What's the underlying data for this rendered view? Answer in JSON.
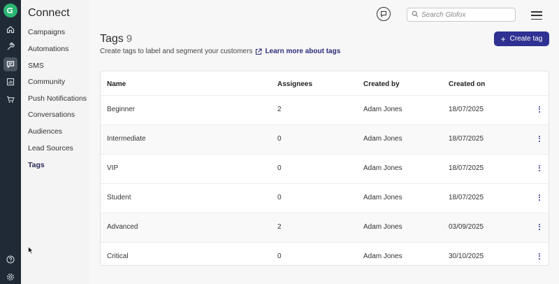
{
  "rail": {
    "icons": [
      "home-icon",
      "wrench-icon",
      "message-icon",
      "chart-icon",
      "cart-icon",
      "help-icon",
      "settings-icon"
    ]
  },
  "subnav": {
    "title": "Connect",
    "items": [
      {
        "label": "Campaigns"
      },
      {
        "label": "Automations"
      },
      {
        "label": "SMS"
      },
      {
        "label": "Community"
      },
      {
        "label": "Push Notifications"
      },
      {
        "label": "Conversations"
      },
      {
        "label": "Audiences"
      },
      {
        "label": "Lead Sources"
      },
      {
        "label": "Tags",
        "active": true
      }
    ]
  },
  "header": {
    "search_placeholder": "Search Glofox"
  },
  "page": {
    "title": "Tags",
    "count": "9",
    "subtitle": "Create tags to label and segment your customers",
    "learn_more": "Learn more about tags",
    "create_button": "Create tag"
  },
  "table": {
    "columns": [
      "Name",
      "Assignees",
      "Created by",
      "Created on"
    ],
    "rows": [
      {
        "name": "Beginner",
        "assignees": "2",
        "created_by": "Adam Jones",
        "created_on": "18/07/2025"
      },
      {
        "name": "Intermediate",
        "assignees": "0",
        "created_by": "Adam Jones",
        "created_on": "18/07/2025"
      },
      {
        "name": "VIP",
        "assignees": "0",
        "created_by": "Adam Jones",
        "created_on": "18/07/2025"
      },
      {
        "name": "Student",
        "assignees": "0",
        "created_by": "Adam Jones",
        "created_on": "18/07/2025"
      },
      {
        "name": "Advanced",
        "assignees": "2",
        "created_by": "Adam Jones",
        "created_on": "03/09/2025"
      },
      {
        "name": "Critical",
        "assignees": "0",
        "created_by": "Adam Jones",
        "created_on": "30/10/2025"
      }
    ]
  },
  "colors": {
    "rail": "#1f2a36",
    "brand_green": "#2bb673",
    "accent": "#2f3192"
  }
}
